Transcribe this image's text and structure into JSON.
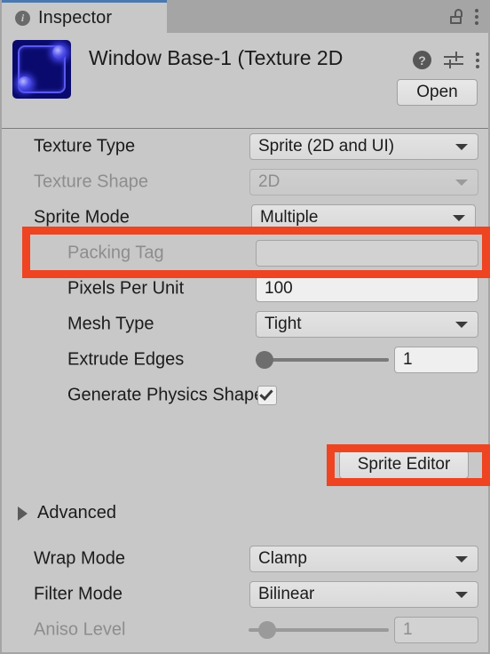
{
  "window": {
    "tab_label": "Inspector",
    "tab_icon": "info-icon",
    "lock_icon": "lock-open-icon",
    "tab_menu_icon": "kebab-menu-icon"
  },
  "object_header": {
    "title": "Window Base-1 (Texture 2D",
    "thumbnail_name": "texture-preview-thumbnail",
    "help_icon": "help-icon",
    "preset_icon": "preset-settings-icon",
    "menu_icon": "kebab-menu-icon",
    "open_button": "Open"
  },
  "properties": [
    {
      "name": "texture-type",
      "label": "Texture Type",
      "control": "dropdown",
      "value": "Sprite (2D and UI)",
      "disabled": false
    },
    {
      "name": "texture-shape",
      "label": "Texture Shape",
      "control": "dropdown",
      "value": "2D",
      "disabled": true
    },
    {
      "name": "sprite-mode",
      "label": "Sprite Mode",
      "control": "dropdown",
      "value": "Multiple",
      "disabled": false
    },
    {
      "name": "packing-tag",
      "label": "Packing Tag",
      "control": "textfield",
      "value": "",
      "disabled": true
    },
    {
      "name": "pixels-per-unit",
      "label": "Pixels Per Unit",
      "control": "textfield",
      "value": "100",
      "disabled": false
    },
    {
      "name": "mesh-type",
      "label": "Mesh Type",
      "control": "dropdown",
      "value": "Tight",
      "disabled": false
    },
    {
      "name": "extrude-edges",
      "label": "Extrude Edges",
      "control": "slider",
      "value": "1",
      "slider_percent": 0,
      "disabled": false
    },
    {
      "name": "generate-physics-shape",
      "label": "Generate Physics Shape",
      "control": "checkbox",
      "value": "checked",
      "disabled": false
    }
  ],
  "sprite_editor_button": "Sprite Editor",
  "advanced_foldout": {
    "label": "Advanced",
    "expanded": false
  },
  "properties2": [
    {
      "name": "wrap-mode",
      "label": "Wrap Mode",
      "control": "dropdown",
      "value": "Clamp",
      "disabled": false
    },
    {
      "name": "filter-mode",
      "label": "Filter Mode",
      "control": "dropdown",
      "value": "Bilinear",
      "disabled": false
    },
    {
      "name": "aniso-level",
      "label": "Aniso Level",
      "control": "slider",
      "value": "1",
      "slider_percent": 7,
      "disabled": true
    }
  ],
  "annotations": [
    {
      "name": "sprite-mode-highlight",
      "target": "sprite-mode"
    },
    {
      "name": "sprite-editor-highlight",
      "target": "sprite-editor-button"
    }
  ],
  "colors": {
    "panel_bg": "#c8c8c8",
    "tabbar_bg": "#a5a5a5",
    "accent_tab": "#4a78b0",
    "annotation_red": "#ee4422",
    "text": "#1b1b1b",
    "text_disabled": "#8d8d8d"
  }
}
